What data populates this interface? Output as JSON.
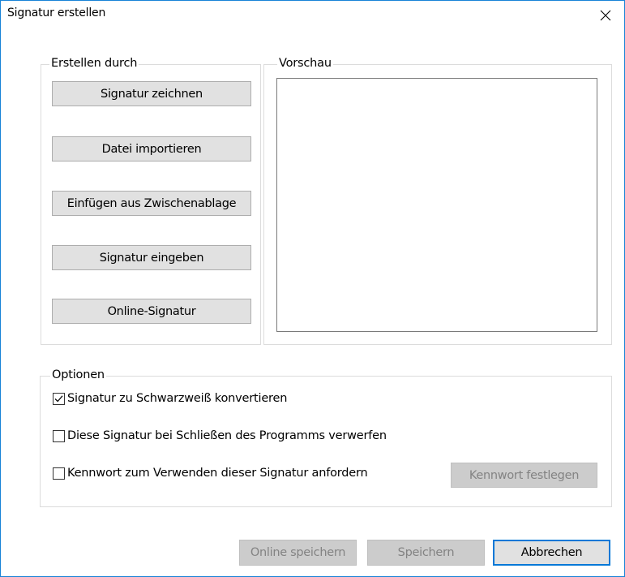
{
  "window": {
    "title": "Signatur erstellen",
    "close_glyph": "close-icon"
  },
  "create_group": {
    "legend": "Erstellen durch",
    "buttons": [
      "Signatur zeichnen",
      "Datei importieren",
      "Einfügen aus Zwischenablage",
      "Signatur eingeben",
      "Online-Signatur"
    ]
  },
  "preview_group": {
    "legend": "Vorschau"
  },
  "options_group": {
    "legend": "Optionen",
    "checkboxes": [
      {
        "label": "Signatur zu Schwarzweiß konvertieren",
        "checked": true
      },
      {
        "label": "Diese Signatur bei Schließen des Programms verwerfen",
        "checked": false
      },
      {
        "label": "Kennwort zum Verwenden dieser Signatur anfordern",
        "checked": false
      }
    ],
    "password_button": "Kennwort festlegen"
  },
  "footer": {
    "online_save": "Online speichern",
    "save": "Speichern",
    "cancel": "Abbrechen"
  },
  "colors": {
    "accent": "#0078d7",
    "window_border": "#1883d7",
    "button_bg": "#e1e1e1",
    "disabled_bg": "#cccccc",
    "disabled_text": "#838383"
  }
}
